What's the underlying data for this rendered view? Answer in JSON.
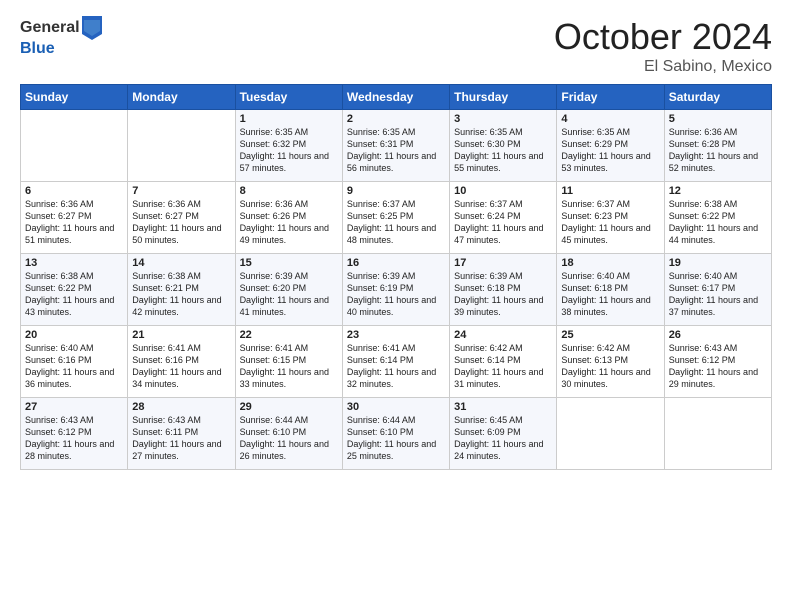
{
  "logo": {
    "general": "General",
    "blue": "Blue"
  },
  "title": "October 2024",
  "location": "El Sabino, Mexico",
  "days_of_week": [
    "Sunday",
    "Monday",
    "Tuesday",
    "Wednesday",
    "Thursday",
    "Friday",
    "Saturday"
  ],
  "weeks": [
    [
      {
        "day": "",
        "sunrise": "",
        "sunset": "",
        "daylight": ""
      },
      {
        "day": "",
        "sunrise": "",
        "sunset": "",
        "daylight": ""
      },
      {
        "day": "1",
        "sunrise": "Sunrise: 6:35 AM",
        "sunset": "Sunset: 6:32 PM",
        "daylight": "Daylight: 11 hours and 57 minutes."
      },
      {
        "day": "2",
        "sunrise": "Sunrise: 6:35 AM",
        "sunset": "Sunset: 6:31 PM",
        "daylight": "Daylight: 11 hours and 56 minutes."
      },
      {
        "day": "3",
        "sunrise": "Sunrise: 6:35 AM",
        "sunset": "Sunset: 6:30 PM",
        "daylight": "Daylight: 11 hours and 55 minutes."
      },
      {
        "day": "4",
        "sunrise": "Sunrise: 6:35 AM",
        "sunset": "Sunset: 6:29 PM",
        "daylight": "Daylight: 11 hours and 53 minutes."
      },
      {
        "day": "5",
        "sunrise": "Sunrise: 6:36 AM",
        "sunset": "Sunset: 6:28 PM",
        "daylight": "Daylight: 11 hours and 52 minutes."
      }
    ],
    [
      {
        "day": "6",
        "sunrise": "Sunrise: 6:36 AM",
        "sunset": "Sunset: 6:27 PM",
        "daylight": "Daylight: 11 hours and 51 minutes."
      },
      {
        "day": "7",
        "sunrise": "Sunrise: 6:36 AM",
        "sunset": "Sunset: 6:27 PM",
        "daylight": "Daylight: 11 hours and 50 minutes."
      },
      {
        "day": "8",
        "sunrise": "Sunrise: 6:36 AM",
        "sunset": "Sunset: 6:26 PM",
        "daylight": "Daylight: 11 hours and 49 minutes."
      },
      {
        "day": "9",
        "sunrise": "Sunrise: 6:37 AM",
        "sunset": "Sunset: 6:25 PM",
        "daylight": "Daylight: 11 hours and 48 minutes."
      },
      {
        "day": "10",
        "sunrise": "Sunrise: 6:37 AM",
        "sunset": "Sunset: 6:24 PM",
        "daylight": "Daylight: 11 hours and 47 minutes."
      },
      {
        "day": "11",
        "sunrise": "Sunrise: 6:37 AM",
        "sunset": "Sunset: 6:23 PM",
        "daylight": "Daylight: 11 hours and 45 minutes."
      },
      {
        "day": "12",
        "sunrise": "Sunrise: 6:38 AM",
        "sunset": "Sunset: 6:22 PM",
        "daylight": "Daylight: 11 hours and 44 minutes."
      }
    ],
    [
      {
        "day": "13",
        "sunrise": "Sunrise: 6:38 AM",
        "sunset": "Sunset: 6:22 PM",
        "daylight": "Daylight: 11 hours and 43 minutes."
      },
      {
        "day": "14",
        "sunrise": "Sunrise: 6:38 AM",
        "sunset": "Sunset: 6:21 PM",
        "daylight": "Daylight: 11 hours and 42 minutes."
      },
      {
        "day": "15",
        "sunrise": "Sunrise: 6:39 AM",
        "sunset": "Sunset: 6:20 PM",
        "daylight": "Daylight: 11 hours and 41 minutes."
      },
      {
        "day": "16",
        "sunrise": "Sunrise: 6:39 AM",
        "sunset": "Sunset: 6:19 PM",
        "daylight": "Daylight: 11 hours and 40 minutes."
      },
      {
        "day": "17",
        "sunrise": "Sunrise: 6:39 AM",
        "sunset": "Sunset: 6:18 PM",
        "daylight": "Daylight: 11 hours and 39 minutes."
      },
      {
        "day": "18",
        "sunrise": "Sunrise: 6:40 AM",
        "sunset": "Sunset: 6:18 PM",
        "daylight": "Daylight: 11 hours and 38 minutes."
      },
      {
        "day": "19",
        "sunrise": "Sunrise: 6:40 AM",
        "sunset": "Sunset: 6:17 PM",
        "daylight": "Daylight: 11 hours and 37 minutes."
      }
    ],
    [
      {
        "day": "20",
        "sunrise": "Sunrise: 6:40 AM",
        "sunset": "Sunset: 6:16 PM",
        "daylight": "Daylight: 11 hours and 36 minutes."
      },
      {
        "day": "21",
        "sunrise": "Sunrise: 6:41 AM",
        "sunset": "Sunset: 6:16 PM",
        "daylight": "Daylight: 11 hours and 34 minutes."
      },
      {
        "day": "22",
        "sunrise": "Sunrise: 6:41 AM",
        "sunset": "Sunset: 6:15 PM",
        "daylight": "Daylight: 11 hours and 33 minutes."
      },
      {
        "day": "23",
        "sunrise": "Sunrise: 6:41 AM",
        "sunset": "Sunset: 6:14 PM",
        "daylight": "Daylight: 11 hours and 32 minutes."
      },
      {
        "day": "24",
        "sunrise": "Sunrise: 6:42 AM",
        "sunset": "Sunset: 6:14 PM",
        "daylight": "Daylight: 11 hours and 31 minutes."
      },
      {
        "day": "25",
        "sunrise": "Sunrise: 6:42 AM",
        "sunset": "Sunset: 6:13 PM",
        "daylight": "Daylight: 11 hours and 30 minutes."
      },
      {
        "day": "26",
        "sunrise": "Sunrise: 6:43 AM",
        "sunset": "Sunset: 6:12 PM",
        "daylight": "Daylight: 11 hours and 29 minutes."
      }
    ],
    [
      {
        "day": "27",
        "sunrise": "Sunrise: 6:43 AM",
        "sunset": "Sunset: 6:12 PM",
        "daylight": "Daylight: 11 hours and 28 minutes."
      },
      {
        "day": "28",
        "sunrise": "Sunrise: 6:43 AM",
        "sunset": "Sunset: 6:11 PM",
        "daylight": "Daylight: 11 hours and 27 minutes."
      },
      {
        "day": "29",
        "sunrise": "Sunrise: 6:44 AM",
        "sunset": "Sunset: 6:10 PM",
        "daylight": "Daylight: 11 hours and 26 minutes."
      },
      {
        "day": "30",
        "sunrise": "Sunrise: 6:44 AM",
        "sunset": "Sunset: 6:10 PM",
        "daylight": "Daylight: 11 hours and 25 minutes."
      },
      {
        "day": "31",
        "sunrise": "Sunrise: 6:45 AM",
        "sunset": "Sunset: 6:09 PM",
        "daylight": "Daylight: 11 hours and 24 minutes."
      },
      {
        "day": "",
        "sunrise": "",
        "sunset": "",
        "daylight": ""
      },
      {
        "day": "",
        "sunrise": "",
        "sunset": "",
        "daylight": ""
      }
    ]
  ]
}
